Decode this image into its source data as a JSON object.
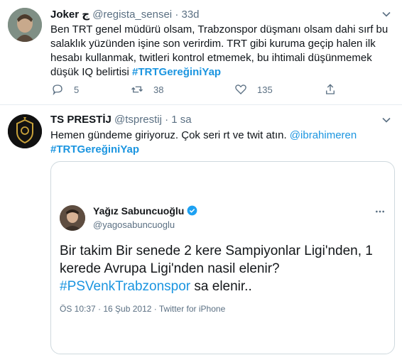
{
  "tweets": [
    {
      "name": "Joker",
      "name_glyph": "ج",
      "handle": "@regista_sensei",
      "dot": "·",
      "time": "33d",
      "text": "Ben TRT genel müdürü olsam, Trabzonspor düşmanı olsam dahi sırf bu salaklık yüzünden işine son verirdim.   TRT gibi kuruma geçip halen ilk hesabı kullanmak, twitleri kontrol etmemek, bu ihtimali düşünmemek düşük IQ belirtisi ",
      "hashtag": "#TRTGereğiniYap",
      "replies": "5",
      "retweets": "38",
      "likes": "135"
    },
    {
      "name": "TS PRESTİJ",
      "handle": "@tsprestij",
      "dot": "·",
      "time": "1 sa",
      "text": "Hemen gündeme giriyoruz. Çok seri rt ve twit atın. ",
      "mention": "@ibrahimeren",
      "hashtag": "#TRTGereğiniYap"
    }
  ],
  "quoted": {
    "name": "Yağız Sabuncuoğlu",
    "handle": "@yagosabuncuoglu",
    "text_a": "Bir takim Bir senede 2 kere Sampiyonlar Ligi'nden, 1 kerede Avrupa Ligi'nden nasil elenir?",
    "hashtag": "#PSVenkTrabzonspor",
    "text_b": " sa elenir..",
    "meta": "ÖS 10:37 · 16 Şub 2012 · Twitter for iPhone"
  },
  "colors": {
    "accent": "#1b95e0",
    "secondary_text": "#5b7083",
    "verified": "#1da1f2"
  },
  "icons": [
    "caret-down-icon",
    "reply-icon",
    "retweet-icon",
    "like-icon",
    "share-icon",
    "verified-icon"
  ]
}
